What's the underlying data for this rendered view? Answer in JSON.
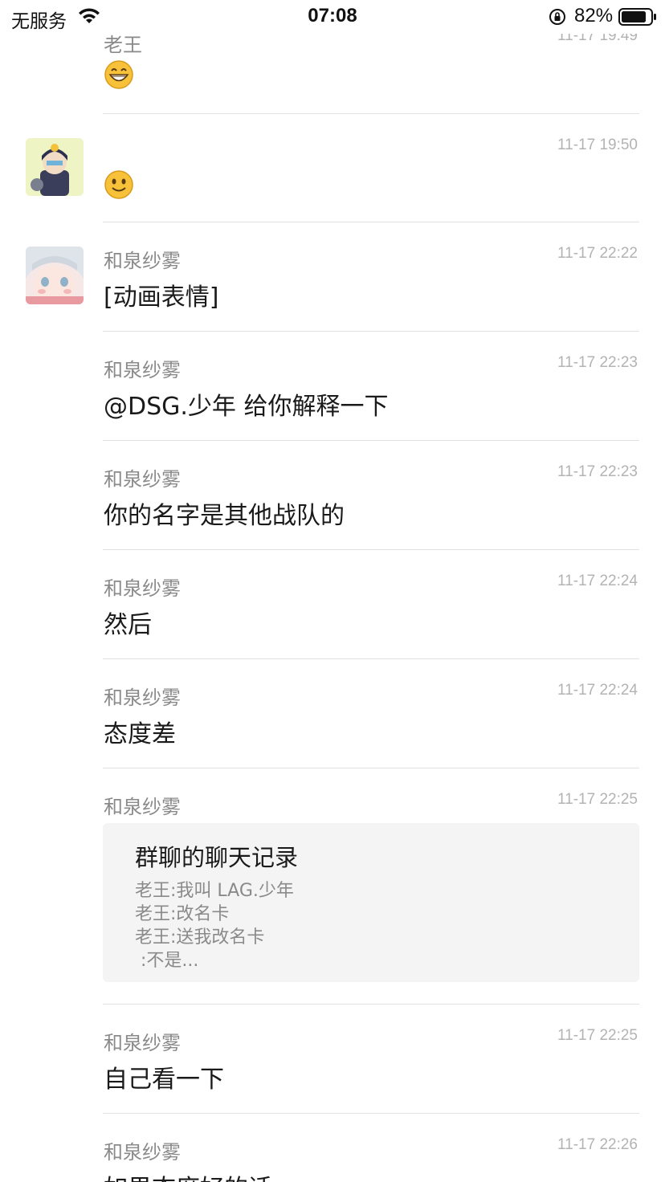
{
  "status_bar": {
    "carrier": "无服务",
    "time": "07:08",
    "battery": "82%",
    "icons": [
      "wifi-icon",
      "orientation-lock-icon",
      "battery-icon"
    ]
  },
  "messages": [
    {
      "sender": "老王",
      "time": "11-17 19:49",
      "content_type": "emoji",
      "emoji": "grinning-face"
    },
    {
      "sender": "",
      "time": "11-17 19:50",
      "content_type": "emoji",
      "emoji": "smiling-face"
    },
    {
      "sender": "和泉纱雾",
      "time": "11-17 22:22",
      "text": "[动画表情]"
    },
    {
      "sender": "和泉纱雾",
      "time": "11-17 22:23",
      "text": "@DSG.少年 给你解释一下"
    },
    {
      "sender": "和泉纱雾",
      "time": "11-17 22:23",
      "text": "你的名字是其他战队的"
    },
    {
      "sender": "和泉纱雾",
      "time": "11-17 22:24",
      "text": "然后"
    },
    {
      "sender": "和泉纱雾",
      "time": "11-17 22:24",
      "text": "态度差"
    },
    {
      "sender": "和泉纱雾",
      "time": "11-17 22:25",
      "content_type": "chat-record",
      "card": {
        "title": "群聊的聊天记录",
        "lines": [
          "老王:我叫 LAG.少年",
          "老王:改名卡",
          "老王:送我改名卡",
          " :不是..."
        ]
      }
    },
    {
      "sender": "和泉纱雾",
      "time": "11-17 22:25",
      "text": "自己看一下"
    },
    {
      "sender": "和泉纱雾",
      "time": "11-17 22:26",
      "text": "如果态度好的话"
    }
  ]
}
